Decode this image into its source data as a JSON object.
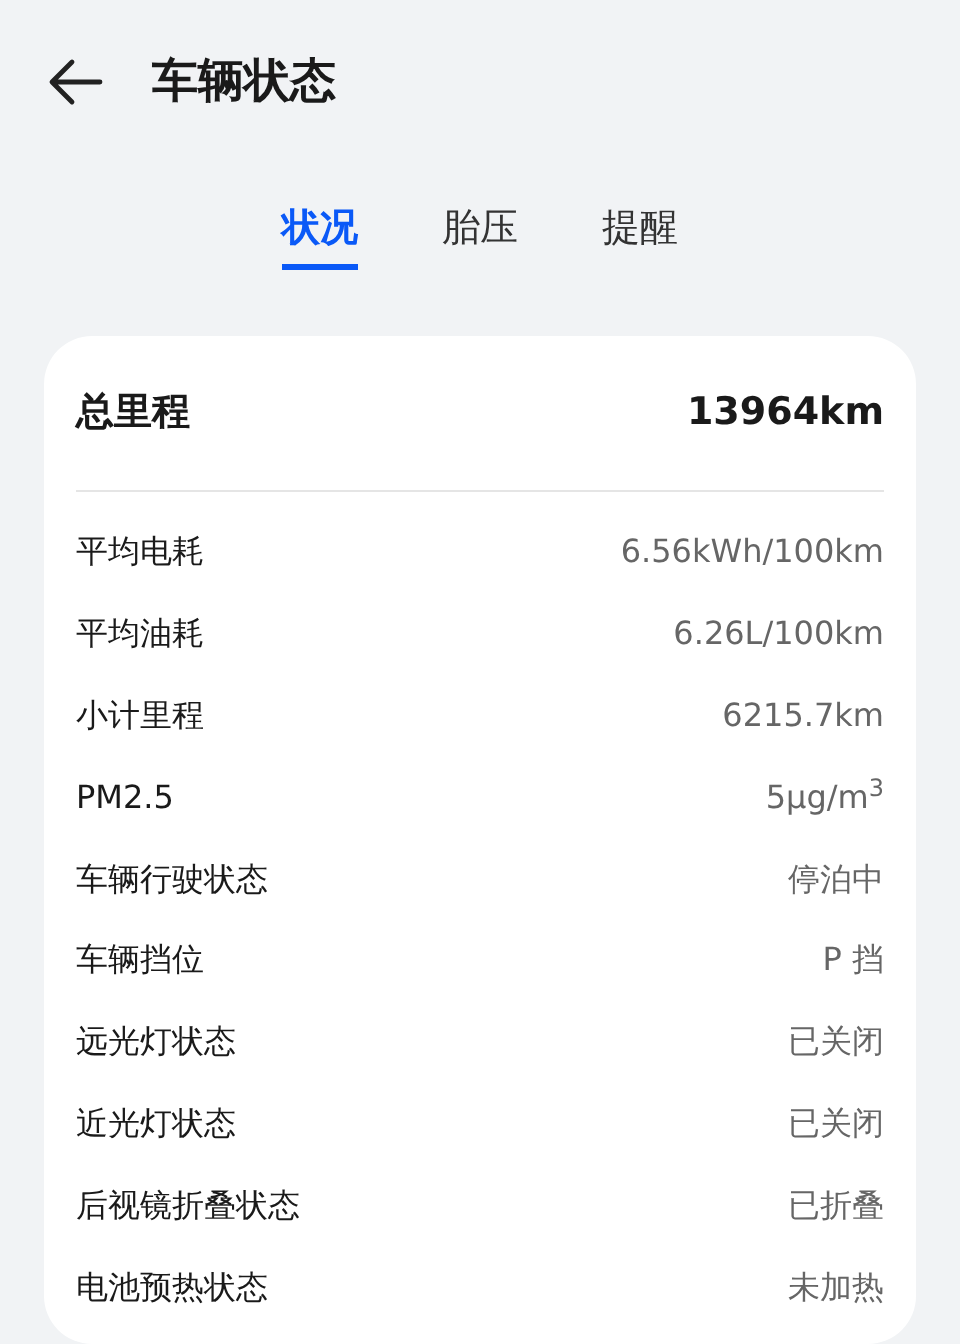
{
  "header": {
    "title": "车辆状态"
  },
  "tabs": [
    {
      "label": "状况",
      "selected": true
    },
    {
      "label": "胎压",
      "selected": false
    },
    {
      "label": "提醒",
      "selected": false
    }
  ],
  "summary": {
    "label": "总里程",
    "value": "13964km"
  },
  "rows": [
    {
      "label": "平均电耗",
      "value": "6.56kWh/100km"
    },
    {
      "label": "平均油耗",
      "value": "6.26L/100km"
    },
    {
      "label": "小计里程",
      "value": "6215.7km"
    },
    {
      "label": "PM2.5",
      "value": "5μg/m$^{3}$"
    },
    {
      "label": "车辆行驶状态",
      "value": "停泊中"
    },
    {
      "label": "车辆挡位",
      "value": "P 挡"
    },
    {
      "label": "远光灯状态",
      "value": "已关闭"
    },
    {
      "label": "近光灯状态",
      "value": "已关闭"
    },
    {
      "label": "后视镜折叠状态",
      "value": "已折叠"
    },
    {
      "label": "电池预热状态",
      "value": "未加热"
    }
  ]
}
